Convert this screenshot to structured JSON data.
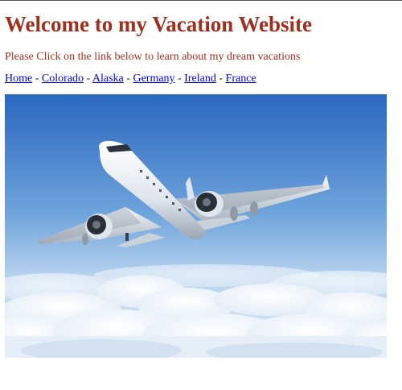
{
  "header": {
    "title": "Welcome to my Vacation Website",
    "intro": "Please Click on the link below to learn about my dream vacations"
  },
  "nav": {
    "separator": " - ",
    "links": [
      {
        "label": "Home"
      },
      {
        "label": "Colorado"
      },
      {
        "label": "Alaska"
      },
      {
        "label": "Germany"
      },
      {
        "label": "Ireland"
      },
      {
        "label": "France"
      }
    ]
  },
  "hero": {
    "subject": "airplane-above-clouds-photo"
  },
  "colors": {
    "heading": "#a0301e",
    "link": "#0000ee",
    "sky_top": "#2e6fc4",
    "sky_bottom": "#cfe3f7"
  }
}
